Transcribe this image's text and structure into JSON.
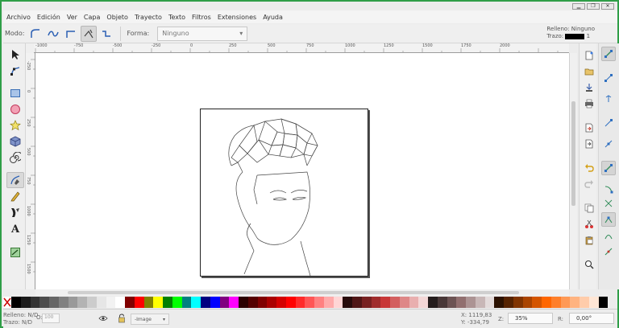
{
  "menu": [
    "Archivo",
    "Edición",
    "Ver",
    "Capa",
    "Objeto",
    "Trayecto",
    "Texto",
    "Filtros",
    "Extensiones",
    "Ayuda"
  ],
  "toolcontrols": {
    "mode_label": "Modo:",
    "shape_label": "Forma:",
    "shape_value": "Ninguno"
  },
  "style_indicator": {
    "fill_label": "Relleno:",
    "fill_value": "Ninguno",
    "stroke_label": "Trazo:",
    "stroke_width": "1"
  },
  "ruler_h": [
    "-1000",
    "-750",
    "-500",
    "-250",
    "0",
    "250",
    "500",
    "750",
    "1000",
    "1250",
    "1500",
    "1750",
    "2000"
  ],
  "ruler_v": [
    "-250",
    "0",
    "250",
    "500",
    "750",
    "1000",
    "1250",
    "1500"
  ],
  "status": {
    "fill_label": "Relleno:",
    "fill_value": "N/D",
    "stroke_label": "Trazo:",
    "stroke_value": "N/D",
    "opacity_label": "O:",
    "opacity_value": "100",
    "layer": "-Image",
    "x_label": "X:",
    "x_value": "1119,83",
    "y_label": "Y:",
    "y_value": "-334,79",
    "zoom_label": "Z:",
    "zoom_value": "35%",
    "rotation_label": "R:",
    "rotation_value": "0,00°"
  },
  "palette": [
    "#000000",
    "#1a1a1a",
    "#333333",
    "#4d4d4d",
    "#666666",
    "#808080",
    "#999999",
    "#b3b3b3",
    "#cccccc",
    "#e6e6e6",
    "#f2f2f2",
    "#ffffff",
    "#800000",
    "#ff0000",
    "#808000",
    "#ffff00",
    "#008000",
    "#00ff00",
    "#008080",
    "#00ffff",
    "#000080",
    "#0000ff",
    "#800080",
    "#ff00ff",
    "#2b0000",
    "#550000",
    "#800000",
    "#aa0000",
    "#d40000",
    "#ff0000",
    "#ff2a2a",
    "#ff5555",
    "#ff8080",
    "#ffaaaa",
    "#ffd5d5",
    "#280b0b",
    "#501616",
    "#782121",
    "#a02c2c",
    "#c83737",
    "#d35f5f",
    "#de8787",
    "#e9afaf",
    "#f4d7d7",
    "#241c1c",
    "#483737",
    "#6c5353",
    "#916f6f",
    "#ac9393",
    "#c8b7b7",
    "#e3dbdb",
    "#2b1100",
    "#552200",
    "#803300",
    "#aa4400",
    "#d45500",
    "#ff6600",
    "#ff7f2a",
    "#ff9955",
    "#ffb380",
    "#ffccaa",
    "#ffe6d5",
    "#000000"
  ]
}
